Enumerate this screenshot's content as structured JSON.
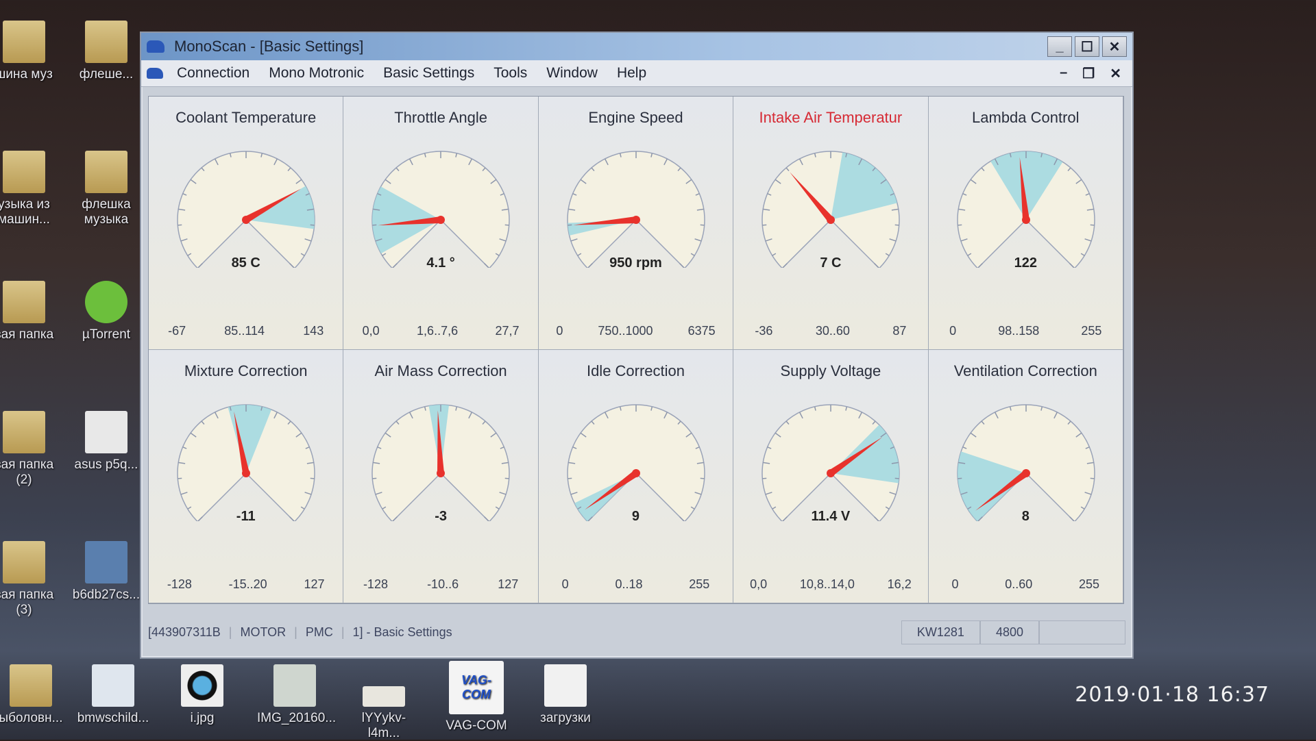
{
  "desktop": {
    "left_icons": [
      {
        "label": "шина муз"
      },
      {
        "label": "флеше..."
      },
      {
        "label": "узыка из машин..."
      },
      {
        "label": "флешка музыка"
      },
      {
        "label": "вая папка"
      },
      {
        "label": "µTorrent"
      },
      {
        "label": "вая папка (2)"
      },
      {
        "label": "asus p5q..."
      },
      {
        "label": "вая папка (3)"
      },
      {
        "label": "b6db27cs..."
      }
    ],
    "bottom_icons": [
      {
        "label": "ыболовн..."
      },
      {
        "label": "bmwschild..."
      },
      {
        "label": "i.jpg"
      },
      {
        "label": "IMG_20160..."
      },
      {
        "label": "lYYykv-l4m..."
      },
      {
        "label": "VAG-COM"
      },
      {
        "label": "загрузки"
      }
    ],
    "timestamp": "2019·01·18  16:37"
  },
  "window": {
    "title": "MonoScan - [Basic Settings]",
    "buttons": {
      "minimize": "_",
      "maximize": "☐",
      "close": "✕"
    },
    "mdi_buttons": {
      "minimize": "–",
      "restore": "❐",
      "close": "✕"
    }
  },
  "menu": [
    "Connection",
    "Mono Motronic",
    "Basic Settings",
    "Tools",
    "Window",
    "Help"
  ],
  "gauges": [
    {
      "title": "Coolant Temperature",
      "display": "85 C",
      "value": 85,
      "min": -67,
      "max": 143,
      "min_label": "-67",
      "max_label": "143",
      "range_label": "85..114",
      "range": [
        85,
        114
      ],
      "alert": false
    },
    {
      "title": "Throttle Angle",
      "display": "4.1 °",
      "value": 4.1,
      "min": 0,
      "max": 27.7,
      "min_label": "0,0",
      "max_label": "27,7",
      "range_label": "1,6..7,6",
      "range": [
        1.6,
        7.6
      ],
      "alert": false
    },
    {
      "title": "Engine Speed",
      "display": "950 rpm",
      "value": 950,
      "min": 0,
      "max": 6375,
      "min_label": "0",
      "max_label": "6375",
      "range_label": "750..1000",
      "range": [
        750,
        1000
      ],
      "alert": false
    },
    {
      "title": "Intake Air Temperatur",
      "display": "7 C",
      "value": 7,
      "min": -36,
      "max": 87,
      "min_label": "-36",
      "max_label": "87",
      "range_label": "30..60",
      "range": [
        30,
        60
      ],
      "alert": true
    },
    {
      "title": "Lambda Control",
      "display": "122",
      "value": 122,
      "min": 0,
      "max": 255,
      "min_label": "0",
      "max_label": "255",
      "range_label": "98..158",
      "range": [
        98,
        158
      ],
      "alert": false
    },
    {
      "title": "Mixture Correction",
      "display": "-11",
      "value": -11,
      "min": -128,
      "max": 127,
      "min_label": "-128",
      "max_label": "127",
      "range_label": "-15..20",
      "range": [
        -15,
        20
      ],
      "alert": false
    },
    {
      "title": "Air Mass Correction",
      "display": "-3",
      "value": -3,
      "min": -128,
      "max": 127,
      "min_label": "-128",
      "max_label": "127",
      "range_label": "-10..6",
      "range": [
        -10,
        6
      ],
      "alert": false
    },
    {
      "title": "Idle Correction",
      "display": "9",
      "value": 9,
      "min": 0,
      "max": 255,
      "min_label": "0",
      "max_label": "255",
      "range_label": "0..18",
      "range": [
        0,
        18
      ],
      "alert": false
    },
    {
      "title": "Supply Voltage",
      "display": "11.4 V",
      "value": 11.4,
      "min": 0,
      "max": 16.2,
      "min_label": "0,0",
      "max_label": "16,2",
      "range_label": "10,8..14,0",
      "range": [
        10.8,
        14.0
      ],
      "alert": false
    },
    {
      "title": "Ventilation Correction",
      "display": "8",
      "value": 8,
      "min": 0,
      "max": 255,
      "min_label": "0",
      "max_label": "255",
      "range_label": "0..60",
      "range": [
        0,
        60
      ],
      "alert": false
    }
  ],
  "status": {
    "part": "[443907311B",
    "module": "MOTOR",
    "system": "PMC",
    "group": "1] - Basic Settings",
    "protocol": "KW1281",
    "baud": "4800"
  },
  "colors": {
    "needle": "#e8322c",
    "range": "#9fd8e0",
    "dial": "#f4f1e2",
    "alert_title": "#d62a34"
  }
}
